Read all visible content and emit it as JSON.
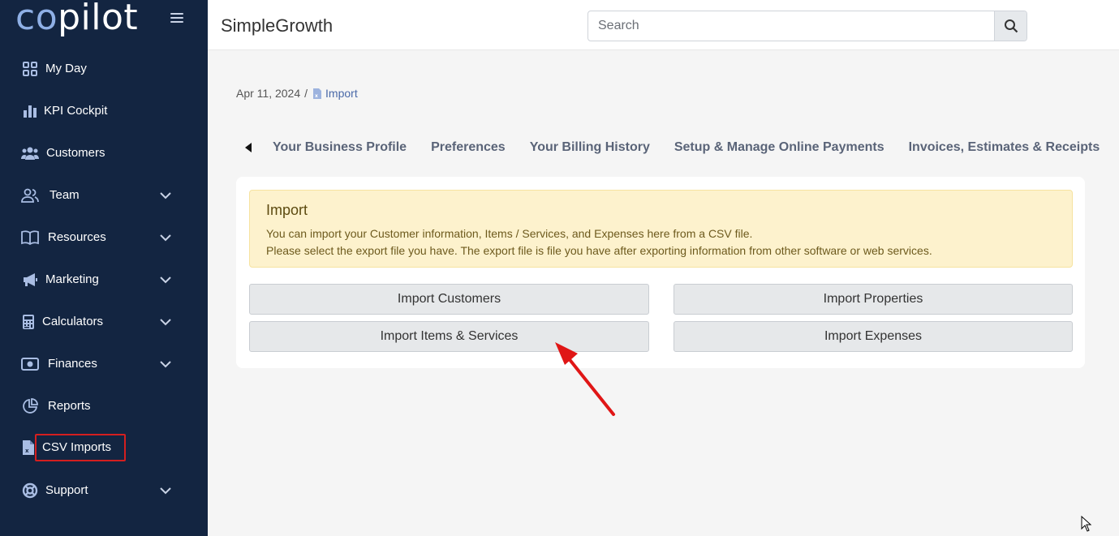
{
  "app": {
    "logo_prefix": "co",
    "logo_suffix": "pilot",
    "company": "SimpleGrowth"
  },
  "search": {
    "placeholder": "Search"
  },
  "sidebar": {
    "items": [
      {
        "label": "My Day",
        "icon": "grid-icon",
        "expandable": false
      },
      {
        "label": "KPI Cockpit",
        "icon": "bar-chart-icon",
        "expandable": false
      },
      {
        "label": "Customers",
        "icon": "users-icon",
        "expandable": false
      },
      {
        "label": "Team",
        "icon": "user-group-icon",
        "expandable": true
      },
      {
        "label": "Resources",
        "icon": "book-icon",
        "expandable": true
      },
      {
        "label": "Marketing",
        "icon": "megaphone-icon",
        "expandable": true
      },
      {
        "label": "Calculators",
        "icon": "calculator-icon",
        "expandable": true
      },
      {
        "label": "Finances",
        "icon": "money-icon",
        "expandable": true
      },
      {
        "label": "Reports",
        "icon": "pie-chart-icon",
        "expandable": false
      },
      {
        "label": "CSV Imports",
        "icon": "csv-file-icon",
        "expandable": false,
        "highlighted": true
      },
      {
        "label": "Support",
        "icon": "lifebuoy-icon",
        "expandable": true
      }
    ]
  },
  "breadcrumb": {
    "date": "Apr 11, 2024",
    "separator": "/",
    "current": "Import"
  },
  "tabs": [
    "Your Business Profile",
    "Preferences",
    "Your Billing History",
    "Setup & Manage Online Payments",
    "Invoices, Estimates & Receipts"
  ],
  "import_panel": {
    "title": "Import",
    "line1": "You can import your Customer information, Items / Services, and Expenses here from a CSV file.",
    "line2": "Please select the export file you have. The export file is file you have after exporting information from other software or web services.",
    "buttons": {
      "customers": "Import Customers",
      "properties": "Import Properties",
      "items_services": "Import Items & Services",
      "expenses": "Import Expenses"
    }
  },
  "colors": {
    "sidebar_bg": "#132541",
    "highlight_border": "#d41f1f",
    "alert_bg": "#fdf2cd",
    "arrow": "#e01616"
  }
}
